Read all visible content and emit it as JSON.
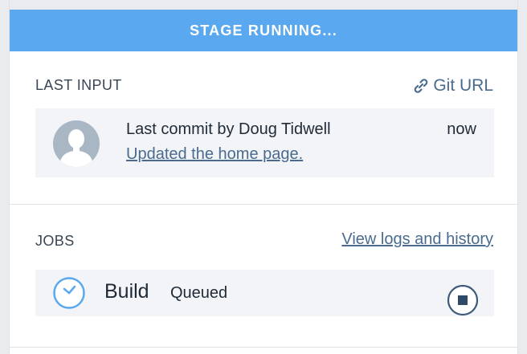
{
  "banner": {
    "text": "STAGE RUNNING..."
  },
  "last_input": {
    "title": "LAST INPUT",
    "git_url_label": "Git URL",
    "commit": {
      "author_line": "Last commit by Doug Tidwell",
      "time": "now",
      "message": "Updated the home page."
    }
  },
  "jobs": {
    "title": "JOBS",
    "view_logs_label": "View logs and history",
    "items": [
      {
        "name": "Build",
        "status": "Queued"
      }
    ]
  },
  "colors": {
    "banner": "#5aa9f0",
    "link": "#4a6b8f",
    "row_bg": "#f2f4f7",
    "icon_blue": "#5aa9f0",
    "stop_icon": "#3d5a7a"
  },
  "icons": {
    "git_url": "link-icon",
    "avatar": "user-avatar",
    "job_state": "clock-icon",
    "stop": "stop-icon"
  }
}
